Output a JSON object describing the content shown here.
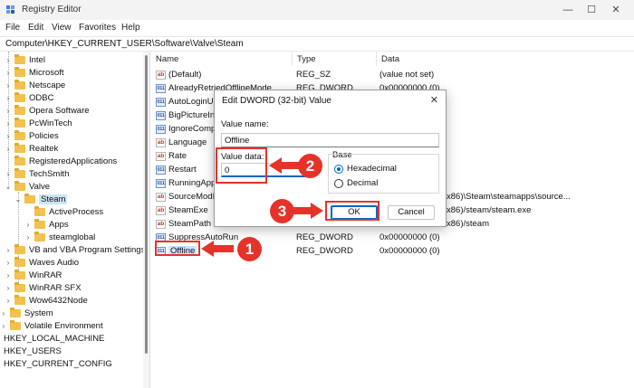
{
  "window": {
    "title": "Registry Editor",
    "controls": {
      "minimize": "—",
      "maximize": "☐",
      "close": "✕"
    }
  },
  "menu": [
    "File",
    "Edit",
    "View",
    "Favorites",
    "Help"
  ],
  "address": "Computer\\HKEY_CURRENT_USER\\Software\\Valve\\Steam",
  "tree": [
    {
      "label": "Intel"
    },
    {
      "label": "Microsoft"
    },
    {
      "label": "Netscape"
    },
    {
      "label": "ODBC"
    },
    {
      "label": "Opera Software"
    },
    {
      "label": "PcWinTech"
    },
    {
      "label": "Policies"
    },
    {
      "label": "Realtek"
    },
    {
      "label": "RegisteredApplications"
    },
    {
      "label": "TechSmith"
    },
    {
      "label": "Valve"
    },
    {
      "label": "Steam"
    },
    {
      "label": "ActiveProcess"
    },
    {
      "label": "Apps"
    },
    {
      "label": "steamglobal"
    },
    {
      "label": "VB and VBA Program Settings"
    },
    {
      "label": "Waves Audio"
    },
    {
      "label": "WinRAR"
    },
    {
      "label": "WinRAR SFX"
    },
    {
      "label": "Wow6432Node"
    },
    {
      "label": "System"
    },
    {
      "label": "Volatile Environment"
    },
    {
      "label": "HKEY_LOCAL_MACHINE"
    },
    {
      "label": "HKEY_USERS"
    },
    {
      "label": "HKEY_CURRENT_CONFIG"
    }
  ],
  "columns": {
    "name": "Name",
    "type": "Type",
    "data": "Data"
  },
  "values": [
    {
      "icon": "ab",
      "name": "(Default)",
      "type": "REG_SZ",
      "data": "(value not set)"
    },
    {
      "icon": "dw",
      "name": "AlreadyRetriedOfflineMode",
      "type": "REG_DWORD",
      "data": "0x00000000 (0)"
    },
    {
      "icon": "dw",
      "name": "AutoLoginUser",
      "type": "",
      "data": ""
    },
    {
      "icon": "dw",
      "name": "BigPictureInForeground",
      "type": "",
      "data": ""
    },
    {
      "icon": "dw",
      "name": "IgnoreCompatWarning",
      "type": "",
      "data": ""
    },
    {
      "icon": "ab",
      "name": "Language",
      "type": "",
      "data": ""
    },
    {
      "icon": "ab",
      "name": "Rate",
      "type": "",
      "data": ""
    },
    {
      "icon": "dw",
      "name": "Restart",
      "type": "",
      "data": ""
    },
    {
      "icon": "dw",
      "name": "RunningAppID",
      "type": "",
      "data": ""
    },
    {
      "icon": "ab",
      "name": "SourceModInstallPath",
      "type": "",
      "data": "x86)\\Steam\\steamapps\\source..."
    },
    {
      "icon": "ab",
      "name": "SteamExe",
      "type": "",
      "data": "x86)/steam/steam.exe"
    },
    {
      "icon": "ab",
      "name": "SteamPath",
      "type": "",
      "data": "x86)/steam"
    },
    {
      "icon": "dw",
      "name": "SuppressAutoRun",
      "type": "REG_DWORD",
      "data": "0x00000000 (0)"
    },
    {
      "icon": "dw",
      "name": "Offline",
      "type": "REG_DWORD",
      "data": "0x00000000 (0)"
    }
  ],
  "dialog": {
    "title": "Edit DWORD (32-bit) Value",
    "close": "✕",
    "value_name_label": "Value name:",
    "value_name": "Offline",
    "value_data_label": "Value data:",
    "value_data": "0",
    "base_label": "Base",
    "hex_label": "Hexadecimal",
    "dec_label": "Decimal",
    "base_selected": "Hexadecimal",
    "ok": "OK",
    "cancel": "Cancel"
  },
  "annotations": {
    "step1": "1",
    "step2": "2",
    "step3": "3",
    "color": "#e5332a"
  },
  "colors": {
    "accent": "#0067c0",
    "selection": "#cce4f7",
    "folder": "#f2c14e"
  }
}
